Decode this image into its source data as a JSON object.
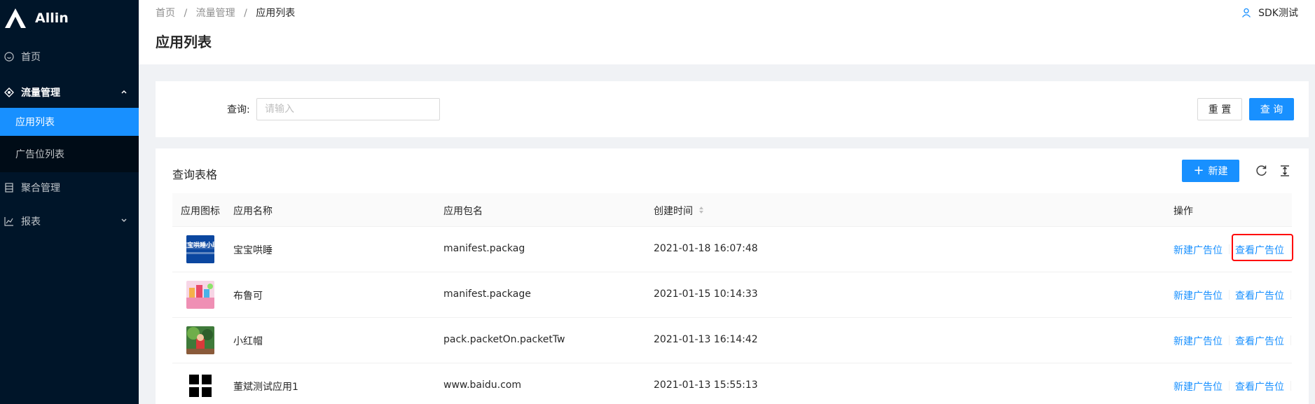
{
  "app": {
    "logo_text": "Allin"
  },
  "sidebar": {
    "items": [
      {
        "label": "首页",
        "icon": "smile-icon"
      },
      {
        "label": "流量管理",
        "icon": "traffic-icon",
        "expanded": true,
        "children": [
          {
            "label": "应用列表",
            "active": true
          },
          {
            "label": "广告位列表"
          }
        ]
      },
      {
        "label": "聚合管理",
        "icon": "database-icon"
      },
      {
        "label": "报表",
        "icon": "line-chart-icon"
      }
    ]
  },
  "header": {
    "breadcrumb": [
      "首页",
      "流量管理",
      "应用列表"
    ],
    "separator": "/",
    "title": "应用列表",
    "user_name": "SDK测试"
  },
  "search": {
    "label": "查询:",
    "placeholder": "请输入",
    "value": "",
    "reset_label": "重 置",
    "query_label": "查 询"
  },
  "table": {
    "title": "查询表格",
    "new_label": "新建",
    "columns": [
      "应用图标",
      "应用名称",
      "应用包名",
      "创建时间",
      "操作"
    ],
    "rows": [
      {
        "name": "宝宝哄睡",
        "package": "manifest.packag",
        "created": "2021-01-18 16:07:48",
        "icon": "baby-sleep-app-icon",
        "icon_text": "宝宝哄睡小助手"
      },
      {
        "name": "布鲁可",
        "package": "manifest.package",
        "created": "2021-01-15 10:14:33",
        "icon": "bloks-app-icon"
      },
      {
        "name": "小红帽",
        "package": "pack.packetOn.packetTw",
        "created": "2021-01-13 16:14:42",
        "icon": "little-red-hat-app-icon"
      },
      {
        "name": "董斌测试应用1",
        "package": "www.baidu.com",
        "created": "2021-01-13 15:55:13",
        "icon": "grid-app-icon"
      }
    ],
    "actions": [
      "新建广告位",
      "查看广告位"
    ]
  },
  "colors": {
    "primary": "#1890ff",
    "sidebar_bg": "#001529",
    "submenu_bg": "#000c17",
    "highlight": "#ff0000"
  }
}
